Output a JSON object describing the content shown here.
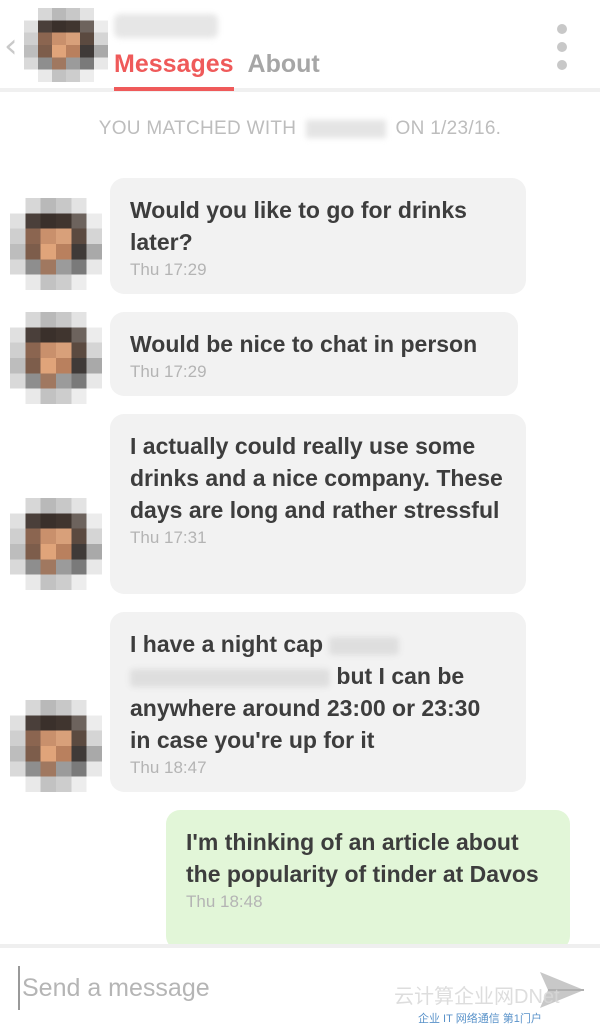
{
  "header": {
    "back_icon": "chevron-left-icon",
    "tabs": [
      {
        "label": "Messages",
        "active": true
      },
      {
        "label": "About",
        "active": false
      }
    ],
    "menu_icon": "kebab-menu-icon"
  },
  "match_line": {
    "prefix": "YOU MATCHED WITH",
    "suffix": "ON 1/23/16."
  },
  "messages": [
    {
      "direction": "incoming",
      "text": "Would you like to go for drinks later?",
      "time": "Thu 17:29"
    },
    {
      "direction": "incoming",
      "text": "Would be nice to chat in person",
      "time": "Thu 17:29"
    },
    {
      "direction": "incoming",
      "text": "I actually could really use some drinks and a nice company. These days are long and rather stressful",
      "time": "Thu 17:31"
    },
    {
      "direction": "incoming",
      "text_start": "I have a night cap",
      "text_end": "but I can be anywhere around 23:00 or 23:30 in case you're up for it",
      "time": "Thu 18:47"
    },
    {
      "direction": "outgoing",
      "text": "I'm thinking of an article about the popularity of tinder at Davos",
      "time": "Thu 18:48"
    }
  ],
  "composer": {
    "placeholder": "Send a message",
    "send_icon": "send-arrow-icon"
  },
  "watermark": {
    "top": "云计算企业网DNet",
    "bottom": "企业 IT 网络通信 第1门户"
  },
  "colors": {
    "accent": "#ef5a5a",
    "incoming_bubble": "#f2f2f2",
    "outgoing_bubble": "#e2f6d8",
    "muted_text": "#b4b4b4"
  }
}
